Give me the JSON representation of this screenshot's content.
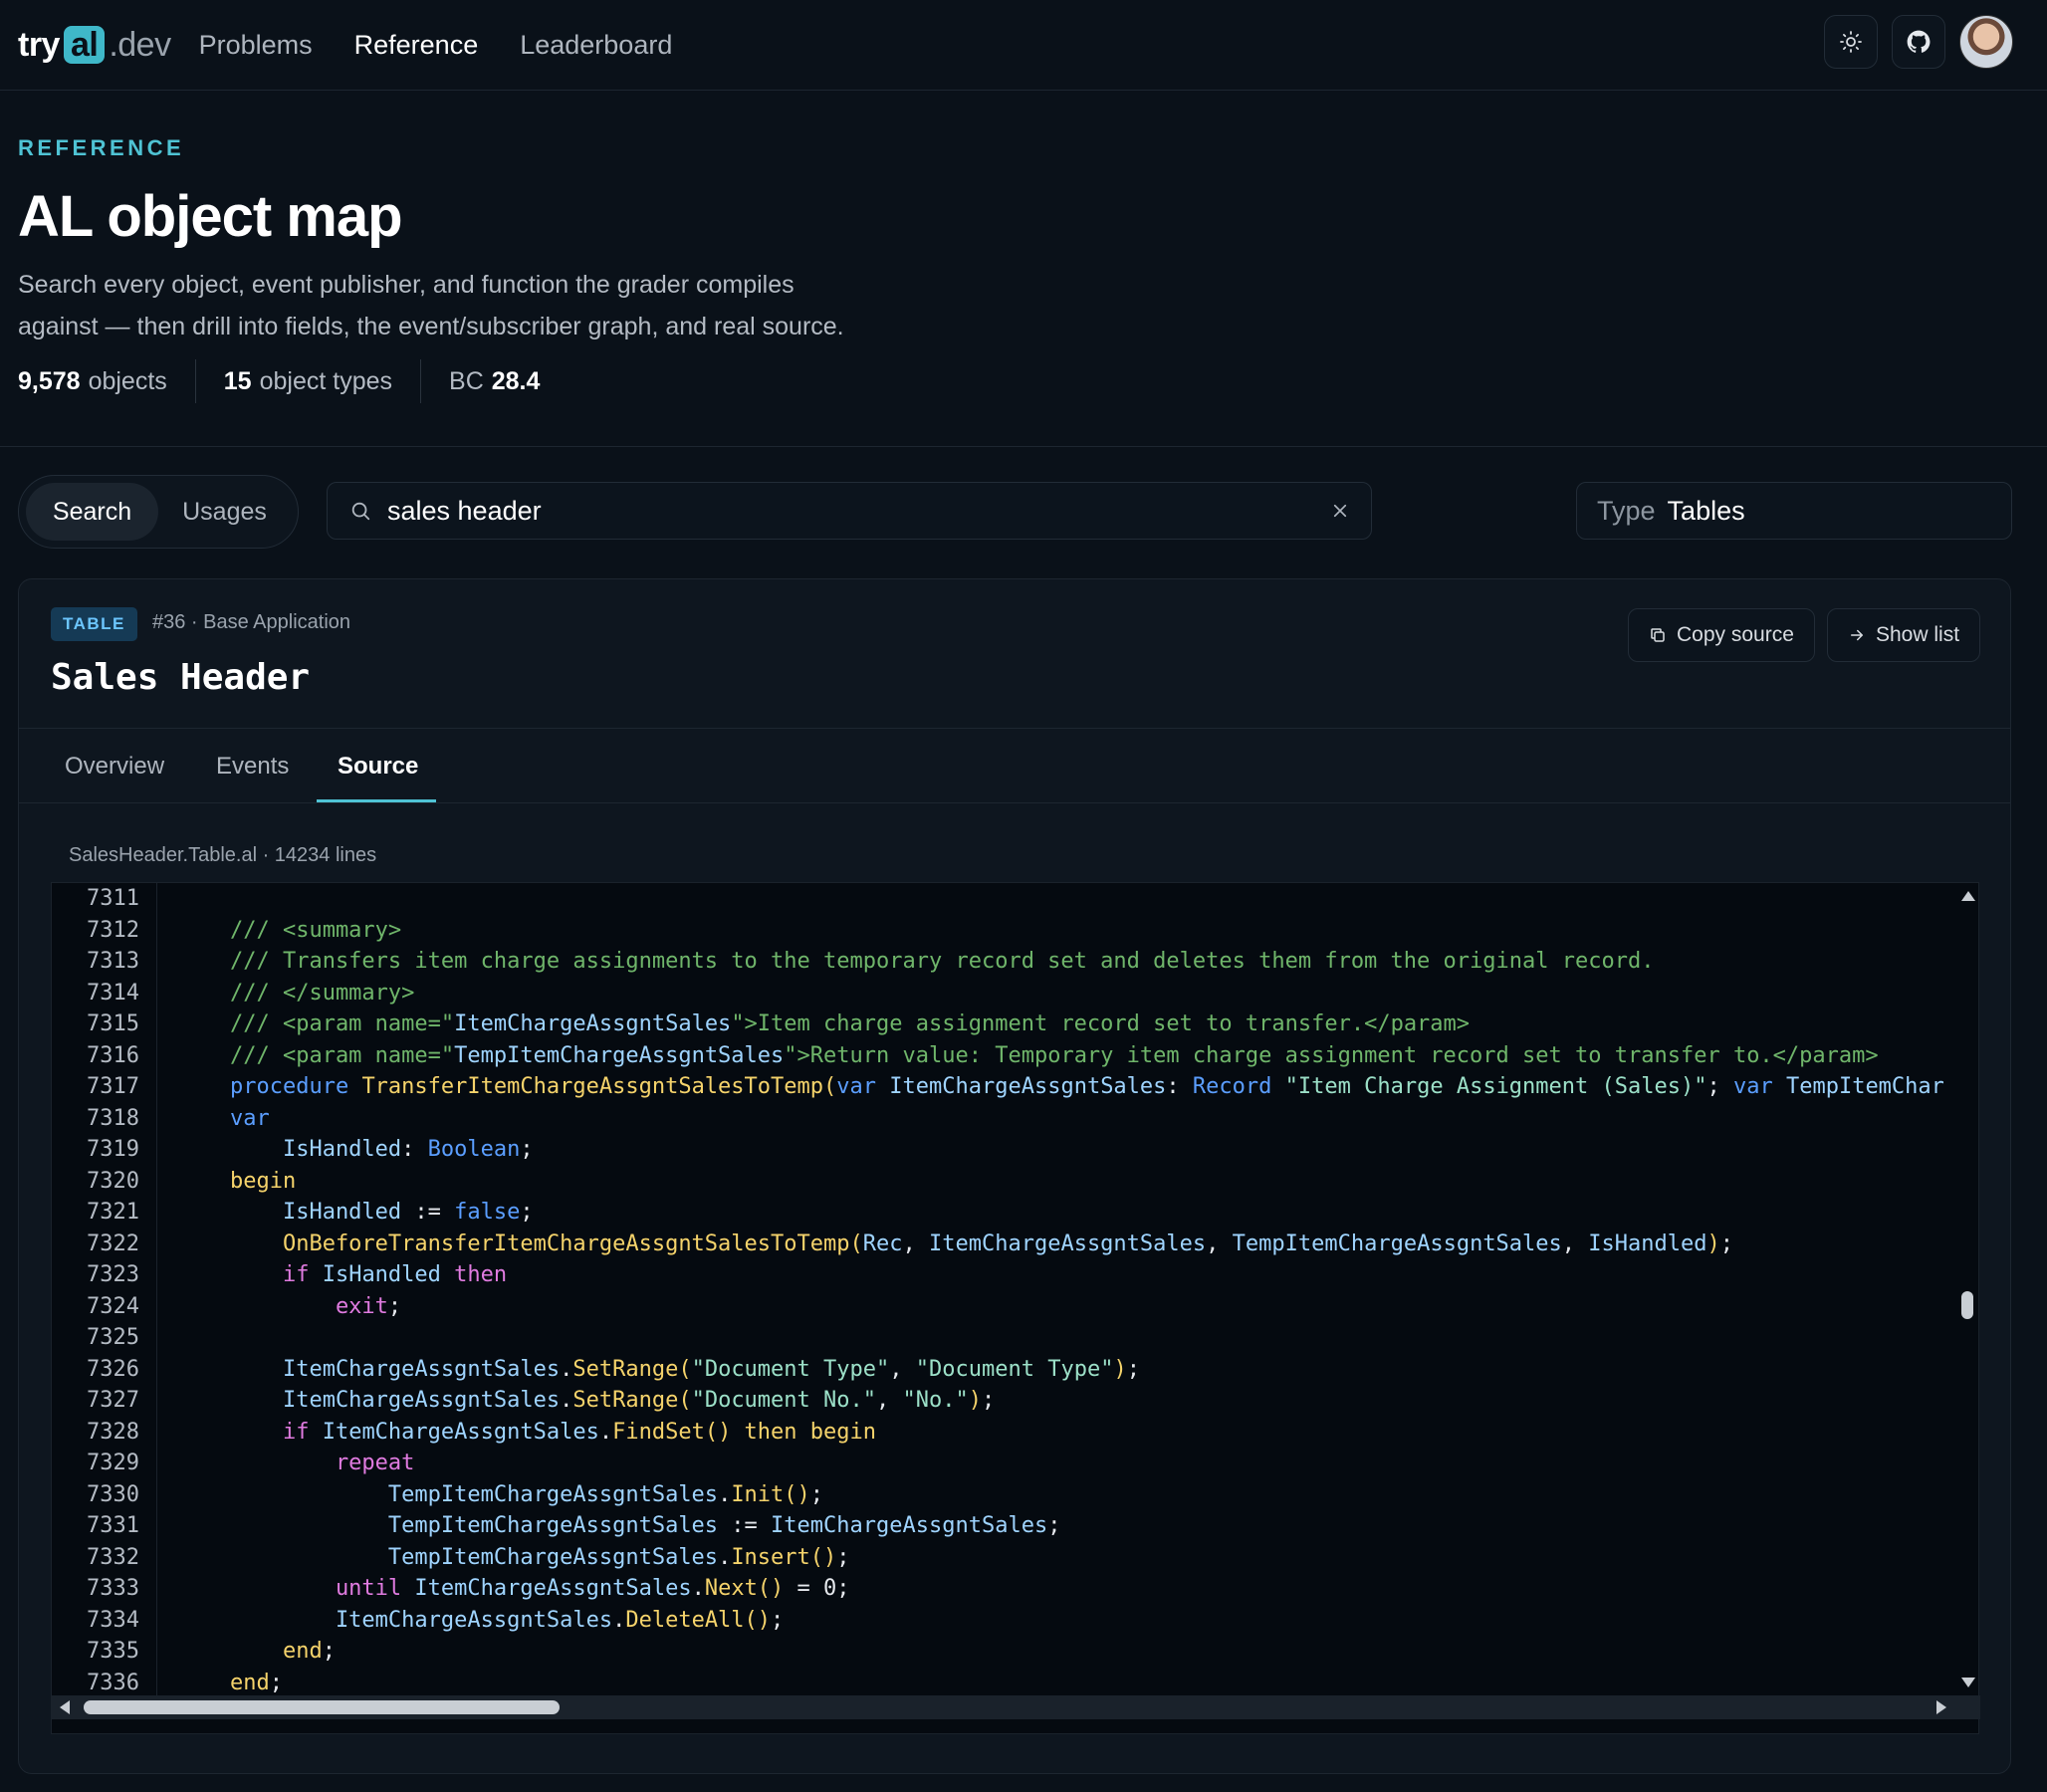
{
  "nav": {
    "logo_try": "try",
    "logo_al": "al",
    "logo_dev": ".dev",
    "links": [
      "Problems",
      "Reference",
      "Leaderboard"
    ],
    "active": "Reference",
    "icons": [
      "sun-icon",
      "github-icon",
      "avatar"
    ]
  },
  "hero": {
    "eyebrow": "REFERENCE",
    "title": "AL object map",
    "description_line1": "Search every object, event publisher, and function the grader compiles",
    "description_line2": "against — then drill into fields, the event/subscriber graph, and real source.",
    "stats": {
      "objects_count": "9,578",
      "objects_label": "objects",
      "types_count": "15",
      "types_label": "object types",
      "bc_label": "BC",
      "bc_version": "28.4"
    }
  },
  "controls": {
    "mode_options": [
      "Search",
      "Usages"
    ],
    "mode_active": "Search",
    "search_value": "sales header",
    "type_label": "Type",
    "type_value": "Tables"
  },
  "object": {
    "badge": "TABLE",
    "meta": "#36 · Base Application",
    "name": "Sales Header",
    "copy_label": "Copy source",
    "show_list_label": "Show list",
    "tabs": [
      "Overview",
      "Events",
      "Source"
    ],
    "active_tab": "Source",
    "file_info": "SalesHeader.Table.al · 14234 lines"
  },
  "code": {
    "line_numbers": [
      "7311",
      "7312",
      "7313",
      "7314",
      "7315",
      "7316",
      "7317",
      "7318",
      "7319",
      "7320",
      "7321",
      "7322",
      "7323",
      "7324",
      "7325",
      "7326",
      "7327",
      "7328",
      "7329",
      "7330",
      "7331",
      "7332",
      "7333",
      "7334",
      "7335",
      "7336"
    ],
    "lines": [
      [],
      [
        [
          "cm",
          "    /// <summary>"
        ]
      ],
      [
        [
          "cm",
          "    /// Transfers item charge assignments to the temporary record set and deletes them from the original record."
        ]
      ],
      [
        [
          "cm",
          "    /// </summary>"
        ]
      ],
      [
        [
          "cm",
          "    /// <param name=\""
        ],
        [
          "id",
          "ItemChargeAssgntSales"
        ],
        [
          "cm",
          "\">Item charge assignment record set to transfer.</param>"
        ]
      ],
      [
        [
          "cm",
          "    /// <param name=\""
        ],
        [
          "id",
          "TempItemChargeAssgntSales"
        ],
        [
          "cm",
          "\">Return value: Temporary item charge assignment record set to transfer to.</param>"
        ]
      ],
      [
        [
          "kw",
          "    procedure "
        ],
        [
          "fn",
          "TransferItemChargeAssgntSalesToTemp"
        ],
        [
          "fn",
          "("
        ],
        [
          "kw",
          "var "
        ],
        [
          "id",
          "ItemChargeAssgntSales"
        ],
        [
          "pn",
          ": "
        ],
        [
          "ty",
          "Record "
        ],
        [
          "str",
          "\"Item Charge Assignment (Sales)\""
        ],
        [
          "pn",
          "; "
        ],
        [
          "kw",
          "var "
        ],
        [
          "id",
          "TempItemChargeAssgntSales"
        ]
      ],
      [
        [
          "kw",
          "    var"
        ]
      ],
      [
        [
          "id",
          "        IsHandled"
        ],
        [
          "pn",
          ": "
        ],
        [
          "ty",
          "Boolean"
        ],
        [
          "pn",
          ";"
        ]
      ],
      [
        [
          "fn",
          "    begin"
        ]
      ],
      [
        [
          "id",
          "        IsHandled "
        ],
        [
          "pn",
          ":= "
        ],
        [
          "kw",
          "false"
        ],
        [
          "pn",
          ";"
        ]
      ],
      [
        [
          "fn",
          "        OnBeforeTransferItemChargeAssgntSalesToTemp("
        ],
        [
          "id",
          "Rec"
        ],
        [
          "pn",
          ", "
        ],
        [
          "id",
          "ItemChargeAssgntSales"
        ],
        [
          "pn",
          ", "
        ],
        [
          "id",
          "TempItemChargeAssgntSales"
        ],
        [
          "pn",
          ", "
        ],
        [
          "id",
          "IsHandled"
        ],
        [
          "fn",
          ")"
        ],
        [
          "pn",
          ";"
        ]
      ],
      [
        [
          "kw2",
          "        if "
        ],
        [
          "id",
          "IsHandled "
        ],
        [
          "kw2",
          "then"
        ]
      ],
      [
        [
          "kw2",
          "            exit"
        ],
        [
          "pn",
          ";"
        ]
      ],
      [],
      [
        [
          "id",
          "        ItemChargeAssgntSales"
        ],
        [
          "pn",
          "."
        ],
        [
          "fn",
          "SetRange("
        ],
        [
          "str",
          "\"Document Type\""
        ],
        [
          "pn",
          ", "
        ],
        [
          "str",
          "\"Document Type\""
        ],
        [
          "fn",
          ")"
        ],
        [
          "pn",
          ";"
        ]
      ],
      [
        [
          "id",
          "        ItemChargeAssgntSales"
        ],
        [
          "pn",
          "."
        ],
        [
          "fn",
          "SetRange("
        ],
        [
          "str",
          "\"Document No.\""
        ],
        [
          "pn",
          ", "
        ],
        [
          "str",
          "\"No.\""
        ],
        [
          "fn",
          ")"
        ],
        [
          "pn",
          ";"
        ]
      ],
      [
        [
          "kw2",
          "        if "
        ],
        [
          "id",
          "ItemChargeAssgntSales"
        ],
        [
          "pn",
          "."
        ],
        [
          "fn",
          "FindSet() then begin"
        ]
      ],
      [
        [
          "kw2",
          "            repeat"
        ]
      ],
      [
        [
          "id",
          "                TempItemChargeAssgntSales"
        ],
        [
          "pn",
          "."
        ],
        [
          "fn",
          "Init()"
        ],
        [
          "pn",
          ";"
        ]
      ],
      [
        [
          "id",
          "                TempItemChargeAssgntSales "
        ],
        [
          "pn",
          ":= "
        ],
        [
          "id",
          "ItemChargeAssgntSales"
        ],
        [
          "pn",
          ";"
        ]
      ],
      [
        [
          "id",
          "                TempItemChargeAssgntSales"
        ],
        [
          "pn",
          "."
        ],
        [
          "fn",
          "Insert()"
        ],
        [
          "pn",
          ";"
        ]
      ],
      [
        [
          "kw2",
          "            until "
        ],
        [
          "id",
          "ItemChargeAssgntSales"
        ],
        [
          "pn",
          "."
        ],
        [
          "fn",
          "Next()"
        ],
        [
          "pn",
          " = 0;"
        ]
      ],
      [
        [
          "id",
          "            ItemChargeAssgntSales"
        ],
        [
          "pn",
          "."
        ],
        [
          "fn",
          "DeleteAll()"
        ],
        [
          "pn",
          ";"
        ]
      ],
      [
        [
          "fn",
          "        end"
        ],
        [
          "pn",
          ";"
        ]
      ],
      [
        [
          "fn",
          "    end"
        ],
        [
          "pn",
          ";"
        ]
      ]
    ]
  }
}
